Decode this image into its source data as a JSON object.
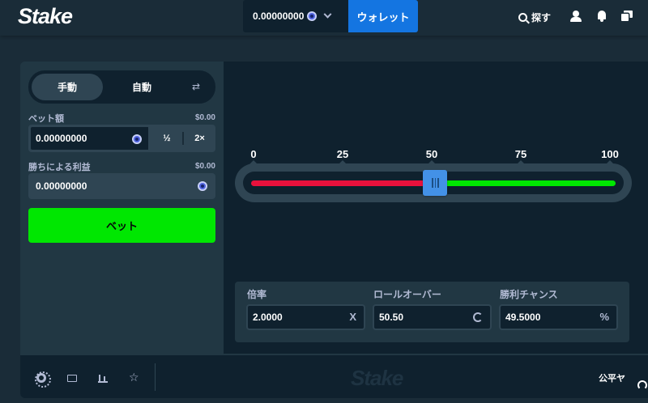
{
  "header": {
    "logo": "Stake",
    "balance": "0.00000000",
    "currency_icon": "crypto-coin",
    "wallet_label": "ウォレット",
    "search_label": "探す"
  },
  "controls": {
    "mode_manual": "手動",
    "mode_auto": "自動",
    "bet_amount_label": "ベット額",
    "bet_amount_usd": "$0.00",
    "bet_amount_value": "0.00000000",
    "half_label": "½",
    "double_label": "2×",
    "profit_label": "勝ちによる利益",
    "profit_usd": "$0.00",
    "profit_value": "0.00000000",
    "bet_button_label": "ベット"
  },
  "slider": {
    "ticks": [
      "0",
      "25",
      "50",
      "75",
      "100"
    ],
    "value": 50.5,
    "min": 0,
    "max": 100,
    "lose_color": "#e9113c",
    "win_color": "#00e701"
  },
  "stats": {
    "multiplier_label": "倍率",
    "multiplier_value": "2.0000",
    "multiplier_suffix": "X",
    "rollover_label": "ロールオーバー",
    "rollover_value": "50.50",
    "win_chance_label": "勝利チャンス",
    "win_chance_value": "49.5000",
    "win_chance_suffix": "%"
  },
  "footer": {
    "watermark": "Stake",
    "fairness_label": "公平ヤ"
  },
  "colors": {
    "accent_blue": "#1475e1",
    "bet_green": "#00e701",
    "background": "#1a2c38"
  }
}
